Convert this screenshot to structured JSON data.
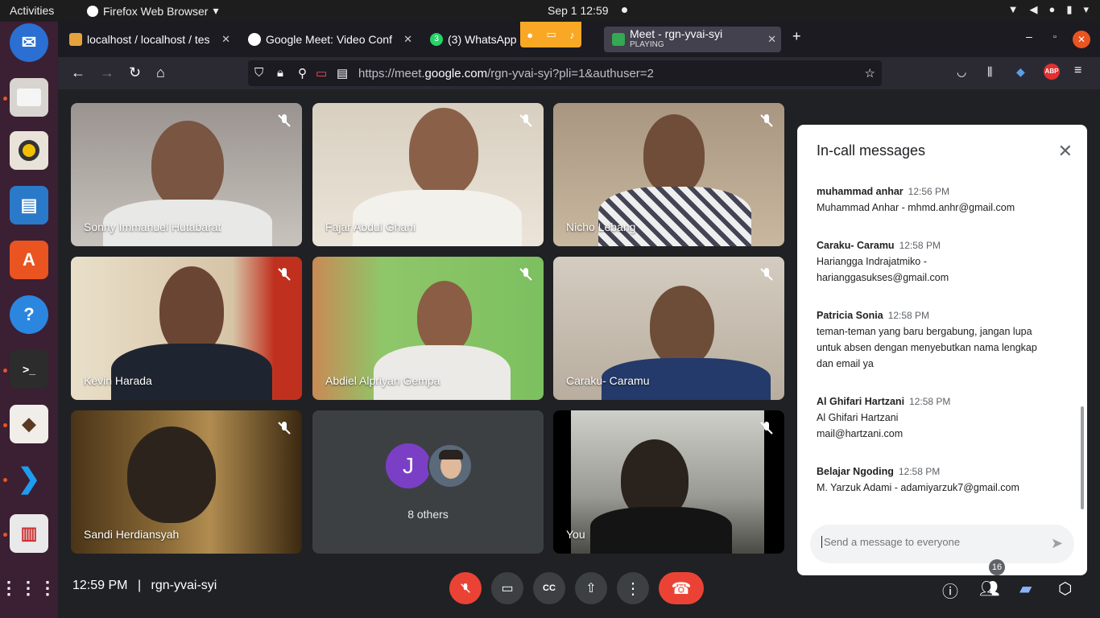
{
  "topbar": {
    "activities": "Activities",
    "app_name": "Firefox Web Browser",
    "clock": "Sep 1  12:59"
  },
  "browser": {
    "tabs": [
      {
        "label": "localhost / localhost / tes"
      },
      {
        "label": "Google Meet: Video Conf"
      },
      {
        "label": "(3) WhatsApp"
      },
      {
        "label": "Meet - rgn-yvai-syi",
        "sub": "PLAYING"
      }
    ],
    "url_host_prefix": "https://meet.",
    "url_host": "google.com",
    "url_path": "/rgn-yvai-syi?pli=1&authuser=2",
    "whatsapp_badge": "3"
  },
  "participants": [
    {
      "name": "Sonny Immanuel Hutabarat"
    },
    {
      "name": "Fajar Abdul Ghani"
    },
    {
      "name": "Nicho Lebang"
    },
    {
      "name": "Kevin Harada"
    },
    {
      "name": "Abdiel Alpriyan Gempa"
    },
    {
      "name": "Caraku- Caramu"
    },
    {
      "name": "Sandi Herdiansyah"
    },
    {
      "name": "You"
    }
  ],
  "others": {
    "avatar_letter": "J",
    "label": "8 others"
  },
  "chat": {
    "title": "In-call messages",
    "messages": [
      {
        "sender": "muhammad anhar",
        "time": "12:56 PM",
        "lines": [
          "Muhammad Anhar - mhmd.anhr@gmail.com"
        ]
      },
      {
        "sender": "Caraku- Caramu",
        "time": "12:58 PM",
        "lines": [
          "Hariangga Indrajatmiko -",
          "harianggasukses@gmail.com"
        ]
      },
      {
        "sender": "Patricia Sonia",
        "time": "12:58 PM",
        "lines": [
          "teman-teman yang baru bergabung, jangan lupa",
          "untuk absen dengan menyebutkan nama lengkap",
          "dan email ya"
        ]
      },
      {
        "sender": "Al Ghifari Hartzani",
        "time": "12:58 PM",
        "lines": [
          "Al Ghifari Hartzani",
          "mail@hartzani.com"
        ]
      },
      {
        "sender": "Belajar Ngoding",
        "time": "12:58 PM",
        "lines": [
          "M. Yarzuk Adami - adamiyarzuk7@gmail.com"
        ]
      }
    ],
    "input_placeholder": "Send a message to everyone"
  },
  "bottom": {
    "time": "12:59 PM",
    "separator": "|",
    "meeting_code": "rgn-yvai-syi",
    "people_count": "16"
  },
  "colors": {
    "accent_blue": "#1a73e8",
    "end_call_red": "#ea4335",
    "dock_bg": "#3b1f33"
  }
}
